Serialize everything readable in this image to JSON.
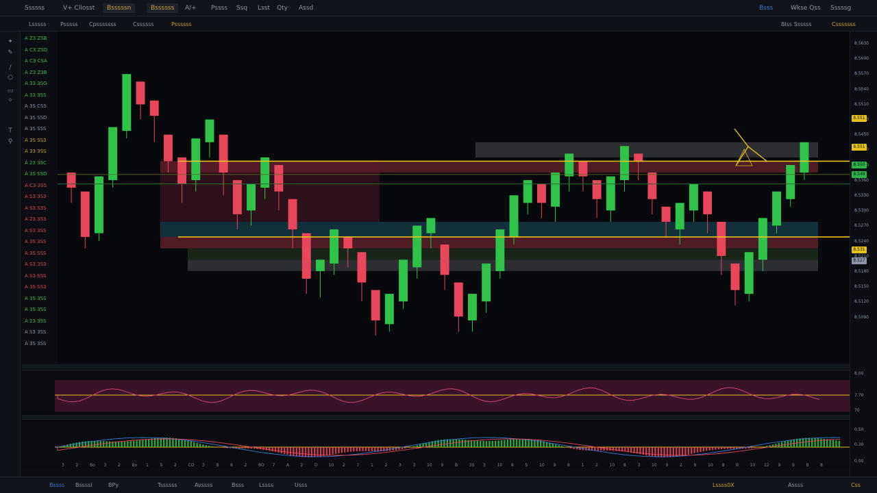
{
  "topbar": {
    "items": [
      "Ssssss",
      "V+ Cllosst",
      "Bsssssn",
      "Bssssss",
      "A/+",
      "Pssss",
      "Ssq",
      "Lsst",
      "Qty",
      "Assd"
    ],
    "right": [
      "Bsss",
      "Wkse Qss",
      "Sssssg"
    ]
  },
  "subbar": {
    "items": [
      "Lsssss",
      "Psssss",
      "Cpsssssss",
      "Cssssss",
      "Pssssss"
    ],
    "right": [
      "Blss Ssssss",
      "Csssssss"
    ]
  },
  "toolbar": {
    "icons": [
      "cursor-icon",
      "pencil-icon",
      "trend-line-icon",
      "circle-icon",
      "ruler-icon",
      "brush-icon",
      "text-icon",
      "magnet-icon"
    ]
  },
  "watchlist": [
    {
      "text": "A Z3 ZSB",
      "color": "#3fbf4e"
    },
    {
      "text": "A C3 ZSD",
      "color": "#3fbf4e"
    },
    {
      "text": "A C3 CSA",
      "color": "#3fbf4e"
    },
    {
      "text": "A Z3 Z3B",
      "color": "#3fbf4e"
    },
    {
      "text": "A 33 3SG",
      "color": "#3fbf4e"
    },
    {
      "text": "A 33 3SS",
      "color": "#3fbf4e"
    },
    {
      "text": "A 3S CSS",
      "color": "#8c94a4"
    },
    {
      "text": "A 3S SSD",
      "color": "#8c94a4"
    },
    {
      "text": "A 3S SSS",
      "color": "#8c94a4"
    },
    {
      "text": "A 3S SS3",
      "color": "#c9a227"
    },
    {
      "text": "A 33 3SS",
      "color": "#c9a227"
    },
    {
      "text": "A 23 3SC",
      "color": "#3fbf4e"
    },
    {
      "text": "A 3S SSD",
      "color": "#3fbf4e"
    },
    {
      "text": "A C3 3SS",
      "color": "#e0455a"
    },
    {
      "text": "A S3 3S3",
      "color": "#e0455a"
    },
    {
      "text": "A S3 S3S",
      "color": "#e0455a"
    },
    {
      "text": "A 23 3S3",
      "color": "#e0455a"
    },
    {
      "text": "A S3 3SS",
      "color": "#e0455a"
    },
    {
      "text": "A 3S 3SS",
      "color": "#e0455a"
    },
    {
      "text": "A 3S SSS",
      "color": "#e0455a"
    },
    {
      "text": "A S3 3S3",
      "color": "#e0455a"
    },
    {
      "text": "A S3 SSS",
      "color": "#e0455a"
    },
    {
      "text": "A 3S SS3",
      "color": "#e0455a"
    },
    {
      "text": "A 3S 3SS",
      "color": "#3fbf4e"
    },
    {
      "text": "A 3S 3SS",
      "color": "#3fbf4e"
    },
    {
      "text": "A 23 3SS",
      "color": "#3fbf4e"
    },
    {
      "text": "A S3 3SS",
      "color": "#8c94a4"
    },
    {
      "text": "A 3S 3SS",
      "color": "#8c94a4"
    }
  ],
  "price_axis": {
    "ticks": [
      "8.5630",
      "8.5600",
      "8.5570",
      "8.5540",
      "8.5510",
      "8.5480",
      "8.5450",
      "8.5420",
      "8.5390",
      "8.5360",
      "8.5330",
      "8.5300",
      "8.5270",
      "8.5240",
      "8.5210",
      "8.5180",
      "8.5150",
      "8.5120",
      "8.5090"
    ],
    "badges": [
      {
        "text": "8.551",
        "color": "#e8c21b"
      },
      {
        "text": "8.551",
        "color": "#e8c21b"
      },
      {
        "text": "8.550",
        "color": "#2bb34a"
      },
      {
        "text": "8.549",
        "color": "#2bb34a"
      },
      {
        "text": "8.531",
        "color": "#e8c21b"
      },
      {
        "text": "8.527",
        "color": "#8c94a4"
      }
    ]
  },
  "rsi_pane": {
    "ticks": [
      "8.00",
      "7.70",
      "70"
    ]
  },
  "macd_pane": {
    "ticks": [
      "0.50",
      "0.30",
      "0.00"
    ]
  },
  "timeaxis": {
    "labels": [
      "3",
      "2",
      "Bo",
      "3",
      "2",
      "Bo",
      "1",
      "S",
      "2",
      "CO",
      "3",
      "B",
      "8",
      "2",
      "BO",
      "7",
      "A",
      "2",
      "D",
      "10",
      "2",
      "7",
      "1",
      "2",
      "3",
      "3",
      "10",
      "9",
      "B",
      "30",
      "3",
      "10",
      "8",
      "S",
      "10",
      "9",
      "8",
      "1",
      "2",
      "10",
      "8",
      "3",
      "10",
      "9",
      "2",
      "9",
      "10",
      "8",
      "B",
      "10",
      "12",
      "9",
      "9",
      "B",
      "8"
    ]
  },
  "bottombar": {
    "items": [
      "Bssss",
      "Bssssl",
      "BPy",
      "Tssssss",
      "Avssss",
      "Bsss",
      "Lssss",
      "Usss"
    ],
    "right": [
      "Lssss0X",
      "Assss",
      "Css"
    ]
  },
  "chart_data": {
    "type": "candlestick",
    "series": [
      {
        "name": "price",
        "values": [
          [
            8.548,
            8.544,
            8.54,
            8.543
          ],
          [
            8.543,
            8.531,
            8.528,
            8.532
          ],
          [
            8.532,
            8.547,
            8.53,
            8.546
          ],
          [
            8.546,
            8.56,
            8.544,
            8.559
          ],
          [
            8.559,
            8.574,
            8.557,
            8.572
          ],
          [
            8.572,
            8.566,
            8.562,
            8.567
          ],
          [
            8.567,
            8.563,
            8.556,
            8.558
          ],
          [
            8.558,
            8.551,
            8.548,
            8.552
          ],
          [
            8.552,
            8.545,
            8.54,
            8.546
          ],
          [
            8.546,
            8.557,
            8.543,
            8.556
          ],
          [
            8.556,
            8.562,
            8.552,
            8.558
          ],
          [
            8.558,
            8.548,
            8.542,
            8.546
          ],
          [
            8.546,
            8.537,
            8.533,
            8.538
          ],
          [
            8.538,
            8.545,
            8.534,
            8.544
          ],
          [
            8.544,
            8.552,
            8.541,
            8.55
          ],
          [
            8.55,
            8.543,
            8.538,
            8.541
          ],
          [
            8.541,
            8.533,
            8.528,
            8.532
          ],
          [
            8.532,
            8.52,
            8.516,
            8.522
          ],
          [
            8.522,
            8.525,
            8.515,
            8.524
          ],
          [
            8.524,
            8.533,
            8.521,
            8.531
          ],
          [
            8.531,
            8.528,
            8.523,
            8.527
          ],
          [
            8.527,
            8.519,
            8.514,
            8.517
          ],
          [
            8.517,
            8.509,
            8.505,
            8.508
          ],
          [
            8.508,
            8.516,
            8.506,
            8.514
          ],
          [
            8.514,
            8.525,
            8.512,
            8.523
          ],
          [
            8.523,
            8.534,
            8.52,
            8.532
          ],
          [
            8.532,
            8.536,
            8.528,
            8.529
          ],
          [
            8.529,
            8.521,
            8.517,
            8.519
          ],
          [
            8.519,
            8.51,
            8.506,
            8.509
          ],
          [
            8.509,
            8.516,
            8.506,
            8.514
          ],
          [
            8.514,
            8.524,
            8.511,
            8.522
          ],
          [
            8.522,
            8.533,
            8.52,
            8.531
          ],
          [
            8.531,
            8.542,
            8.529,
            8.54
          ],
          [
            8.54,
            8.546,
            8.537,
            8.545
          ],
          [
            8.545,
            8.54,
            8.536,
            8.539
          ],
          [
            8.539,
            8.548,
            8.535,
            8.547
          ],
          [
            8.547,
            8.553,
            8.543,
            8.551
          ],
          [
            8.551,
            8.547,
            8.543,
            8.546
          ],
          [
            8.546,
            8.541,
            8.536,
            8.538
          ],
          [
            8.538,
            8.547,
            8.535,
            8.546
          ],
          [
            8.546,
            8.555,
            8.543,
            8.553
          ],
          [
            8.553,
            8.551,
            8.546,
            8.548
          ],
          [
            8.548,
            8.541,
            8.537,
            8.539
          ],
          [
            8.539,
            8.535,
            8.531,
            8.533
          ],
          [
            8.533,
            8.54,
            8.529,
            8.538
          ],
          [
            8.538,
            8.545,
            8.535,
            8.543
          ],
          [
            8.543,
            8.537,
            8.532,
            8.535
          ],
          [
            8.535,
            8.526,
            8.521,
            8.524
          ],
          [
            8.524,
            8.517,
            8.513,
            8.516
          ],
          [
            8.516,
            8.527,
            8.514,
            8.525
          ],
          [
            8.525,
            8.536,
            8.522,
            8.534
          ],
          [
            8.534,
            8.543,
            8.532,
            8.541
          ],
          [
            8.541,
            8.55,
            8.539,
            8.548
          ],
          [
            8.548,
            8.556,
            8.546,
            8.555
          ]
        ]
      }
    ],
    "levels": [
      8.551,
      8.531
    ],
    "zones": [
      {
        "from": 8.548,
        "to": 8.551,
        "color": "#8a2a3a"
      },
      {
        "from": 8.531,
        "to": 8.535,
        "color": "#1a5060"
      },
      {
        "from": 8.528,
        "to": 8.531,
        "color": "#8a2a3a"
      },
      {
        "from": 8.525,
        "to": 8.528,
        "color": "#2a3d25"
      },
      {
        "from": 8.522,
        "to": 8.525,
        "color": "#4a4d52"
      },
      {
        "from": 8.552,
        "to": 8.556,
        "color": "#4a4d52"
      }
    ]
  },
  "colors": {
    "up": "#2fc34a",
    "down": "#e8465b",
    "level": "#e8c21b",
    "accent": "#c9a227"
  }
}
